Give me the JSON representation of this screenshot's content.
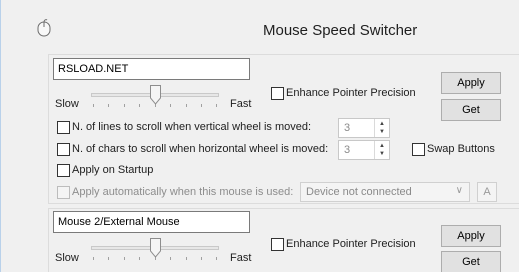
{
  "window": {
    "title": "Mouse Speed Switcher",
    "icon": "mouse-icon"
  },
  "mouse1": {
    "name": "RSLOAD.NET",
    "slow_label": "Slow",
    "fast_label": "Fast",
    "speed_level": 0.5,
    "enhance_label": "Enhance Pointer Precision",
    "enhance_checked": false,
    "apply_label": "Apply",
    "get_label": "Get",
    "vlines_label": "N. of lines to scroll when vertical wheel is moved:",
    "vlines_value": "3",
    "hchars_label": "N. of chars to scroll when  horizontal wheel is moved:",
    "hchars_value": "3",
    "swap_label": "Swap Buttons",
    "startup_label": "Apply on Startup",
    "auto_label": "Apply automatically when this mouse is used:",
    "device_value": "Device not connected",
    "device_btn": "A"
  },
  "mouse2": {
    "name": "Mouse 2/External Mouse",
    "slow_label": "Slow",
    "fast_label": "Fast",
    "speed_level": 0.5,
    "enhance_label": "Enhance Pointer Precision",
    "enhance_checked": false,
    "apply_label": "Apply",
    "get_label": "Get"
  }
}
